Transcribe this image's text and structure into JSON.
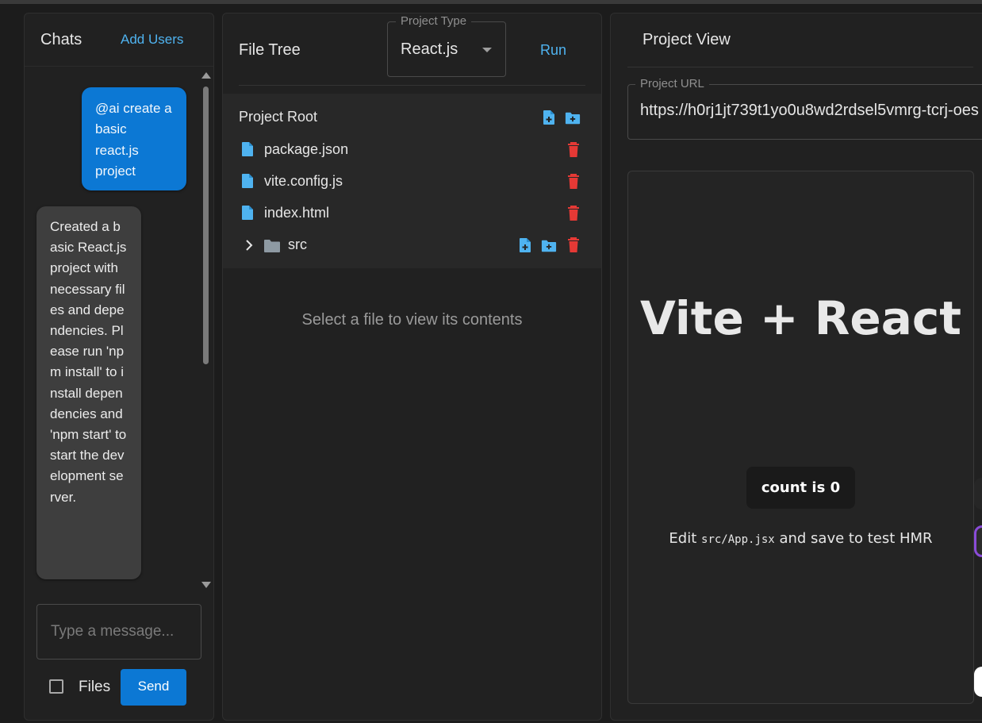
{
  "chat": {
    "title": "Chats",
    "add_users_label": "Add Users",
    "messages": [
      {
        "role": "user",
        "text": "@ai create a basic react.js project"
      },
      {
        "role": "ai",
        "text": "Created a basic React.js project with necessary files and dependencies. Please run 'npm install' to install dependencies and 'npm start' to start the development server."
      }
    ],
    "input_placeholder": "Type a message...",
    "files_label": "Files",
    "files_checked": false,
    "send_label": "Send"
  },
  "file_tree": {
    "title": "File Tree",
    "project_type_legend": "Project Type",
    "project_type_value": "React.js",
    "run_label": "Run",
    "root_label": "Project Root",
    "items": [
      {
        "name": "package.json",
        "type": "file"
      },
      {
        "name": "vite.config.js",
        "type": "file"
      },
      {
        "name": "index.html",
        "type": "file"
      },
      {
        "name": "src",
        "type": "folder",
        "expanded": false
      }
    ],
    "empty_message": "Select a file to view its contents"
  },
  "project_view": {
    "title": "Project View",
    "url_legend": "Project URL",
    "url_value": "https://h0rj1jt739t1yo0u8wd2rdsel5vmrg-tcrj-oes",
    "preview": {
      "heading": "Vite + React",
      "count_label": "count is 0",
      "edit_prefix": "Edit",
      "edit_code": "src/App.jsx",
      "edit_suffix": "and save to test HMR"
    }
  },
  "colors": {
    "accent": "#0c78d4",
    "link": "#4fb3f0",
    "delete": "#e53935",
    "background": "#1c1c1c",
    "panel": "#212121"
  },
  "icons": [
    "add-file-icon",
    "add-folder-icon",
    "file-icon",
    "folder-icon",
    "chevron-right-icon",
    "delete-icon",
    "caret-down-icon"
  ]
}
